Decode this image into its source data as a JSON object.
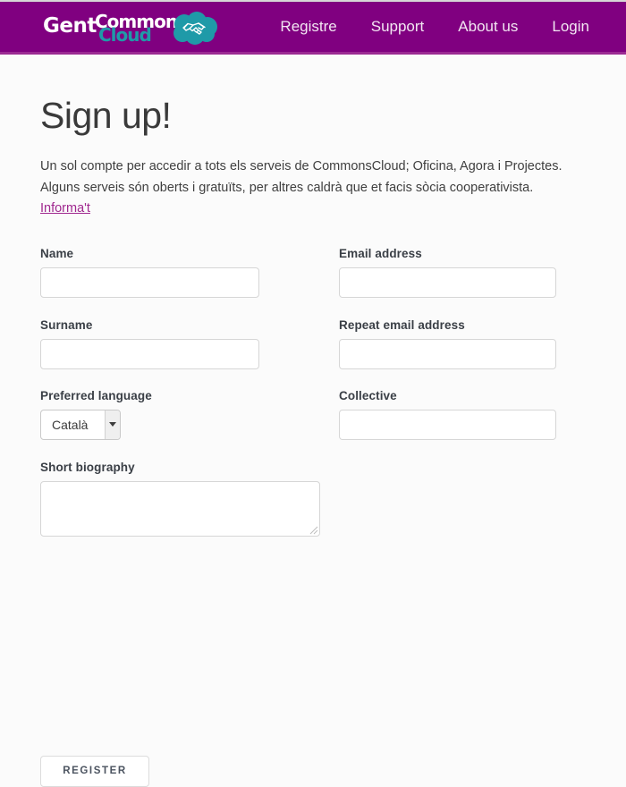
{
  "header": {
    "brand": {
      "gent": "Gent",
      "commons": "Commons",
      "cloud": "Cloud",
      "icon": "cloud-handshake-icon",
      "brand_purple": "#800080",
      "brand_teal": "#1f9aa8"
    },
    "nav": [
      {
        "label": "Registre",
        "name": "nav-link-registre"
      },
      {
        "label": "Support",
        "name": "nav-link-support"
      },
      {
        "label": "About us",
        "name": "nav-link-about-us"
      },
      {
        "label": "Login",
        "name": "nav-link-login"
      }
    ]
  },
  "main": {
    "title": "Sign up!",
    "intro_line1": "Un sol compte per accedir a tots els serveis de CommonsCloud; Oficina, Agora i Projectes.",
    "intro_line2": "Alguns serveis són oberts i gratuïts, per altres caldrà que et facis sòcia cooperativista.",
    "intro_link": "Informa't",
    "link_color": "#a0288f"
  },
  "form": {
    "name": {
      "label": "Name",
      "value": "",
      "placeholder": ""
    },
    "email": {
      "label": "Email address",
      "value": "",
      "placeholder": ""
    },
    "surname": {
      "label": "Surname",
      "value": "",
      "placeholder": ""
    },
    "repeat_email": {
      "label": "Repeat email address",
      "value": "",
      "placeholder": ""
    },
    "preferred_language": {
      "label": "Preferred language",
      "selected": "Català",
      "options": [
        "Català"
      ]
    },
    "collective": {
      "label": "Collective",
      "value": "",
      "placeholder": ""
    },
    "biography": {
      "label": "Short biography",
      "value": "",
      "placeholder": ""
    },
    "submit_label": "REGISTER"
  }
}
